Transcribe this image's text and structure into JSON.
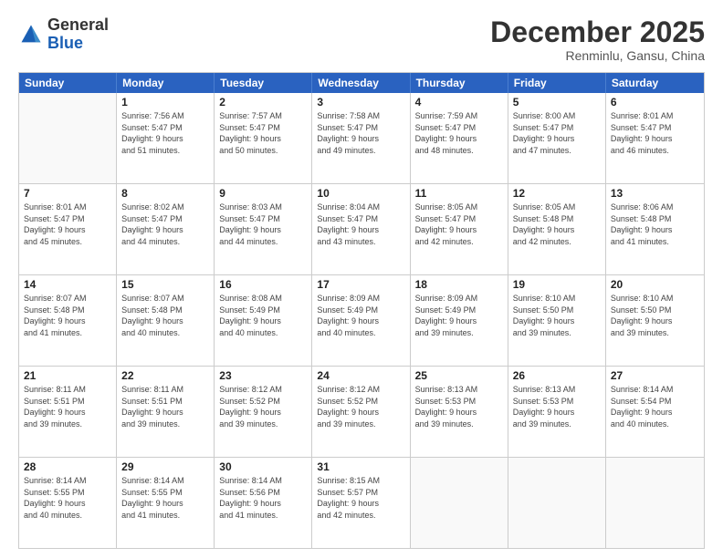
{
  "header": {
    "logo_general": "General",
    "logo_blue": "Blue",
    "month_title": "December 2025",
    "location": "Renminlu, Gansu, China"
  },
  "calendar": {
    "days_of_week": [
      "Sunday",
      "Monday",
      "Tuesday",
      "Wednesday",
      "Thursday",
      "Friday",
      "Saturday"
    ],
    "weeks": [
      [
        {
          "day": "",
          "info": ""
        },
        {
          "day": "1",
          "info": "Sunrise: 7:56 AM\nSunset: 5:47 PM\nDaylight: 9 hours\nand 51 minutes."
        },
        {
          "day": "2",
          "info": "Sunrise: 7:57 AM\nSunset: 5:47 PM\nDaylight: 9 hours\nand 50 minutes."
        },
        {
          "day": "3",
          "info": "Sunrise: 7:58 AM\nSunset: 5:47 PM\nDaylight: 9 hours\nand 49 minutes."
        },
        {
          "day": "4",
          "info": "Sunrise: 7:59 AM\nSunset: 5:47 PM\nDaylight: 9 hours\nand 48 minutes."
        },
        {
          "day": "5",
          "info": "Sunrise: 8:00 AM\nSunset: 5:47 PM\nDaylight: 9 hours\nand 47 minutes."
        },
        {
          "day": "6",
          "info": "Sunrise: 8:01 AM\nSunset: 5:47 PM\nDaylight: 9 hours\nand 46 minutes."
        }
      ],
      [
        {
          "day": "7",
          "info": "Sunrise: 8:01 AM\nSunset: 5:47 PM\nDaylight: 9 hours\nand 45 minutes."
        },
        {
          "day": "8",
          "info": "Sunrise: 8:02 AM\nSunset: 5:47 PM\nDaylight: 9 hours\nand 44 minutes."
        },
        {
          "day": "9",
          "info": "Sunrise: 8:03 AM\nSunset: 5:47 PM\nDaylight: 9 hours\nand 44 minutes."
        },
        {
          "day": "10",
          "info": "Sunrise: 8:04 AM\nSunset: 5:47 PM\nDaylight: 9 hours\nand 43 minutes."
        },
        {
          "day": "11",
          "info": "Sunrise: 8:05 AM\nSunset: 5:47 PM\nDaylight: 9 hours\nand 42 minutes."
        },
        {
          "day": "12",
          "info": "Sunrise: 8:05 AM\nSunset: 5:48 PM\nDaylight: 9 hours\nand 42 minutes."
        },
        {
          "day": "13",
          "info": "Sunrise: 8:06 AM\nSunset: 5:48 PM\nDaylight: 9 hours\nand 41 minutes."
        }
      ],
      [
        {
          "day": "14",
          "info": "Sunrise: 8:07 AM\nSunset: 5:48 PM\nDaylight: 9 hours\nand 41 minutes."
        },
        {
          "day": "15",
          "info": "Sunrise: 8:07 AM\nSunset: 5:48 PM\nDaylight: 9 hours\nand 40 minutes."
        },
        {
          "day": "16",
          "info": "Sunrise: 8:08 AM\nSunset: 5:49 PM\nDaylight: 9 hours\nand 40 minutes."
        },
        {
          "day": "17",
          "info": "Sunrise: 8:09 AM\nSunset: 5:49 PM\nDaylight: 9 hours\nand 40 minutes."
        },
        {
          "day": "18",
          "info": "Sunrise: 8:09 AM\nSunset: 5:49 PM\nDaylight: 9 hours\nand 39 minutes."
        },
        {
          "day": "19",
          "info": "Sunrise: 8:10 AM\nSunset: 5:50 PM\nDaylight: 9 hours\nand 39 minutes."
        },
        {
          "day": "20",
          "info": "Sunrise: 8:10 AM\nSunset: 5:50 PM\nDaylight: 9 hours\nand 39 minutes."
        }
      ],
      [
        {
          "day": "21",
          "info": "Sunrise: 8:11 AM\nSunset: 5:51 PM\nDaylight: 9 hours\nand 39 minutes."
        },
        {
          "day": "22",
          "info": "Sunrise: 8:11 AM\nSunset: 5:51 PM\nDaylight: 9 hours\nand 39 minutes."
        },
        {
          "day": "23",
          "info": "Sunrise: 8:12 AM\nSunset: 5:52 PM\nDaylight: 9 hours\nand 39 minutes."
        },
        {
          "day": "24",
          "info": "Sunrise: 8:12 AM\nSunset: 5:52 PM\nDaylight: 9 hours\nand 39 minutes."
        },
        {
          "day": "25",
          "info": "Sunrise: 8:13 AM\nSunset: 5:53 PM\nDaylight: 9 hours\nand 39 minutes."
        },
        {
          "day": "26",
          "info": "Sunrise: 8:13 AM\nSunset: 5:53 PM\nDaylight: 9 hours\nand 39 minutes."
        },
        {
          "day": "27",
          "info": "Sunrise: 8:14 AM\nSunset: 5:54 PM\nDaylight: 9 hours\nand 40 minutes."
        }
      ],
      [
        {
          "day": "28",
          "info": "Sunrise: 8:14 AM\nSunset: 5:55 PM\nDaylight: 9 hours\nand 40 minutes."
        },
        {
          "day": "29",
          "info": "Sunrise: 8:14 AM\nSunset: 5:55 PM\nDaylight: 9 hours\nand 41 minutes."
        },
        {
          "day": "30",
          "info": "Sunrise: 8:14 AM\nSunset: 5:56 PM\nDaylight: 9 hours\nand 41 minutes."
        },
        {
          "day": "31",
          "info": "Sunrise: 8:15 AM\nSunset: 5:57 PM\nDaylight: 9 hours\nand 42 minutes."
        },
        {
          "day": "",
          "info": ""
        },
        {
          "day": "",
          "info": ""
        },
        {
          "day": "",
          "info": ""
        }
      ]
    ]
  }
}
